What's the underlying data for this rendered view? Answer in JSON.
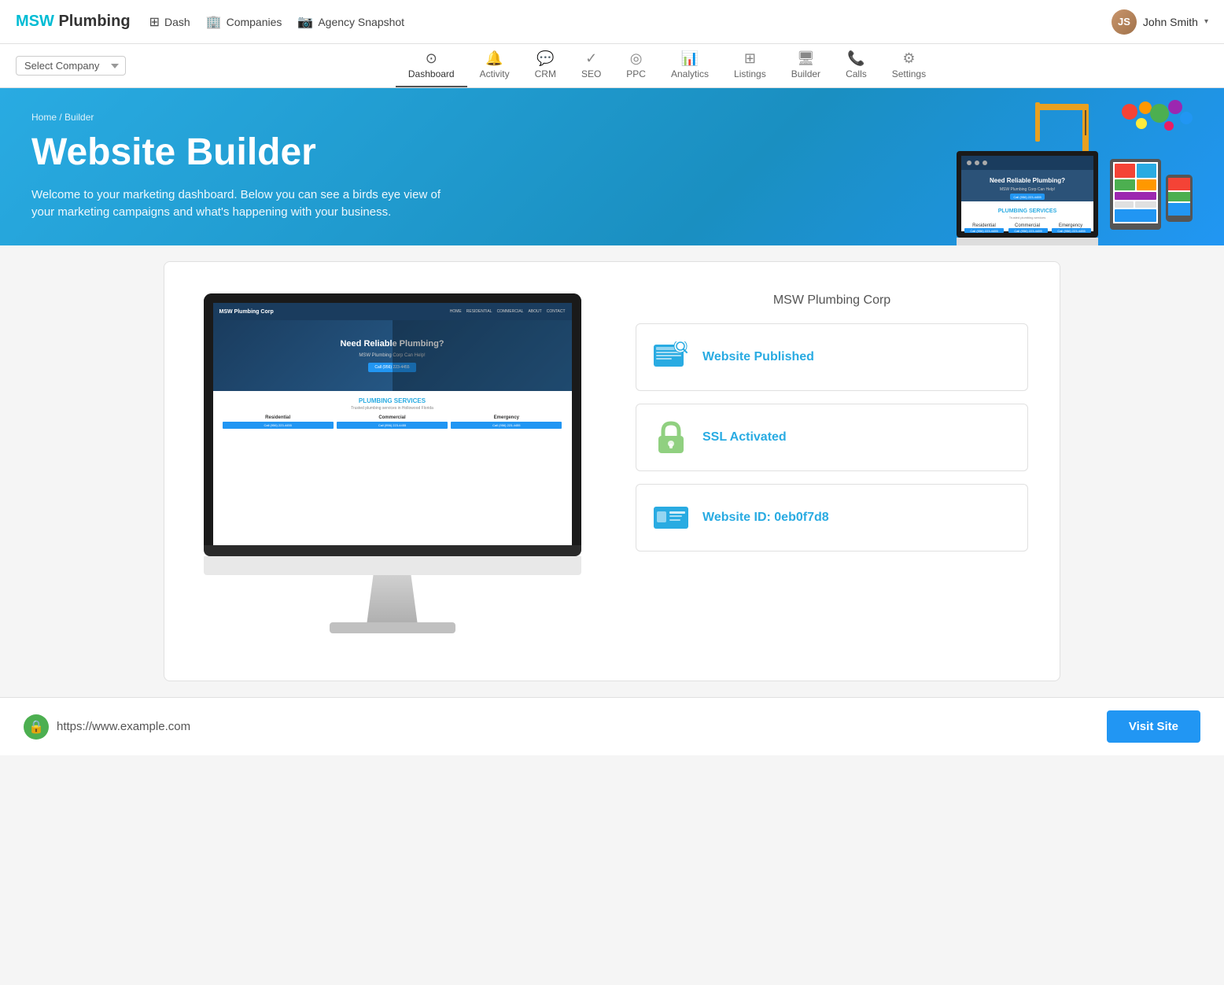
{
  "brand": {
    "msw": "MSW",
    "plumbing": " Plumbing"
  },
  "topNav": {
    "items": [
      {
        "label": "Dash",
        "icon": "dashboard-icon"
      },
      {
        "label": "Companies",
        "icon": "companies-icon"
      },
      {
        "label": "Agency Snapshot",
        "icon": "snapshot-icon"
      }
    ],
    "user": {
      "name": "John Smith",
      "initials": "JS"
    }
  },
  "companySelect": {
    "placeholder": "Select Company"
  },
  "navTabs": [
    {
      "label": "Dashboard",
      "icon": "⊙",
      "active": true
    },
    {
      "label": "Activity",
      "icon": "🔔"
    },
    {
      "label": "CRM",
      "icon": "💬"
    },
    {
      "label": "SEO",
      "icon": "✓"
    },
    {
      "label": "PPC",
      "icon": "◎"
    },
    {
      "label": "Analytics",
      "icon": "📊"
    },
    {
      "label": "Listings",
      "icon": "⊞"
    },
    {
      "label": "Builder",
      "icon": "🖥"
    },
    {
      "label": "Calls",
      "icon": "📞"
    },
    {
      "label": "Settings",
      "icon": "⚙"
    }
  ],
  "hero": {
    "breadcrumb": "Home / Builder",
    "title": "Website Builder",
    "subtitle": "Welcome to your marketing dashboard. Below you can see a birds eye view of your marketing campaigns and what's happening with your business."
  },
  "preview": {
    "companyName": "MSW Plumbing Corp",
    "websiteTitle": "Need Reliable Plumbing?",
    "websiteSubtitle": "MSW Plumbing Corp Can Help!",
    "ctaButton": "Call (956) 223-4455",
    "sectionTitle": "PLUMBING SERVICES",
    "sectionSubtitle": "Trusted plumbing services in Hollowood Florida",
    "services": [
      "Residential",
      "Commercial",
      "Emergency"
    ],
    "serviceButtons": [
      "Call (956) 223-4455",
      "Call (956) 223-4455",
      "Call (956) 223-4455"
    ]
  },
  "statusCards": [
    {
      "id": "published",
      "label": "Website Published",
      "iconType": "website"
    },
    {
      "id": "ssl",
      "label": "SSL Activated",
      "iconType": "lock"
    },
    {
      "id": "websiteId",
      "label": "Website ID: 0eb0f7d8",
      "iconType": "id"
    }
  ],
  "bottomBar": {
    "url": "https://www.example.com",
    "urlPrefix": "https://",
    "urlDomain": "www.example.com",
    "visitButton": "Visit Site"
  },
  "colors": {
    "brand": "#29abe2",
    "accent": "#2196f3",
    "green": "#4caf50",
    "sslGreen": "#90d080"
  }
}
